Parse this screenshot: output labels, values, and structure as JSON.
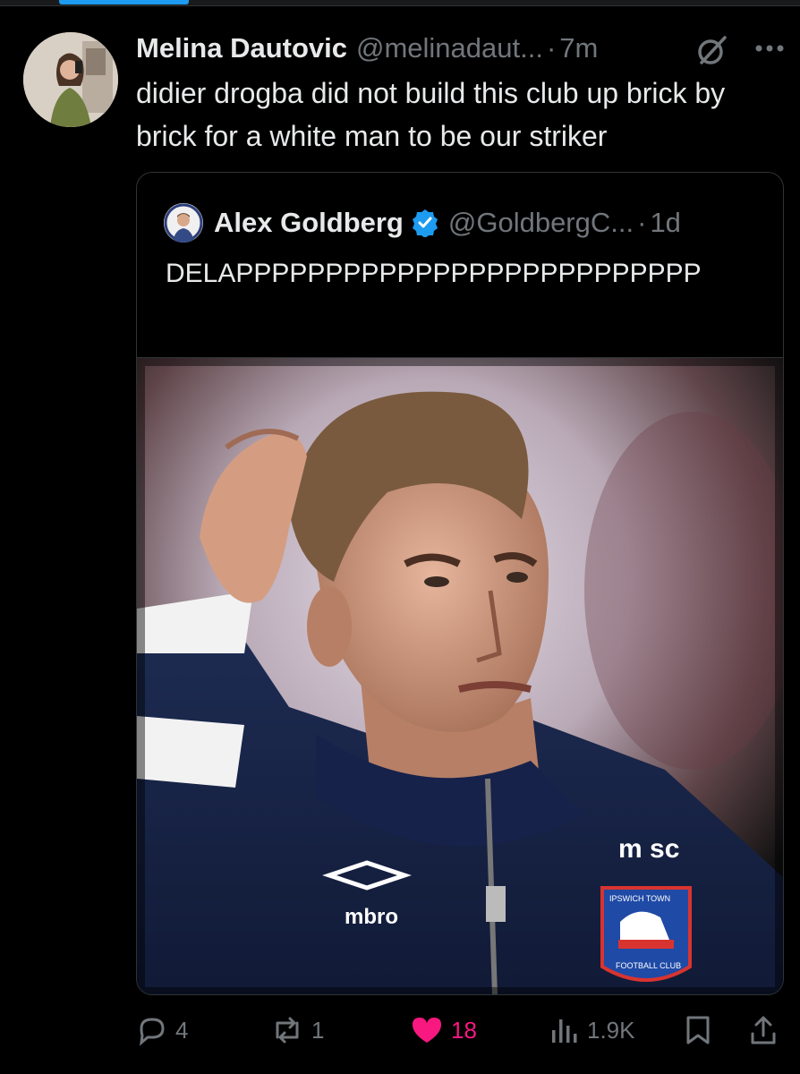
{
  "tweet": {
    "author_name": "Melina Dautovic",
    "author_handle": "@melinadaut...",
    "separator": "·",
    "time": "7m",
    "text": "didier drogba did not build this club up brick by brick for a white man to be our striker",
    "icons": [
      "grok-icon",
      "more-icon"
    ]
  },
  "quote": {
    "author_name": "Alex Goldberg",
    "author_handle": "@GoldbergC...",
    "separator": "·",
    "time": "1d",
    "text": "DELAPPPPPPPPPPPPPPPPPPPPPPPPPP",
    "verified": true,
    "image": {
      "jacket_brand": "mbro",
      "sponsor_text": "m sc",
      "crest_top": "IPSWICH TOWN",
      "crest_bottom": "FOOTBALL CLUB"
    }
  },
  "actions": {
    "replies": "4",
    "reposts": "1",
    "likes": "18",
    "views": "1.9K"
  },
  "colors": {
    "accent": "#1d9bf0",
    "like": "#f91880",
    "muted": "#71767b",
    "text": "#e7e9ea",
    "background": "#000000"
  }
}
